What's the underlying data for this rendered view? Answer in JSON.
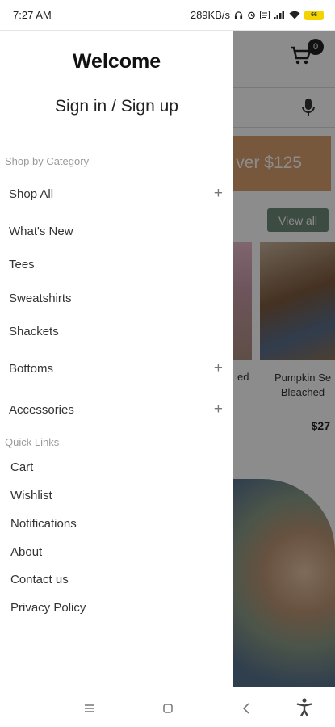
{
  "status": {
    "time": "7:27 AM",
    "speed": "289KB/s",
    "battery": "66"
  },
  "drawer": {
    "welcome": "Welcome",
    "signin": "Sign in / Sign up",
    "category_label": "Shop by Category",
    "categories": [
      {
        "label": "Shop All",
        "expandable": true
      },
      {
        "label": "What's New",
        "expandable": false
      },
      {
        "label": "Tees",
        "expandable": false
      },
      {
        "label": "Sweatshirts",
        "expandable": false
      },
      {
        "label": "Shackets",
        "expandable": false
      },
      {
        "label": "Bottoms",
        "expandable": true
      },
      {
        "label": "Accessories",
        "expandable": true
      }
    ],
    "quick_links_label": "Quick Links",
    "quick_links": [
      "Cart",
      "Wishlist",
      "Notifications",
      "About",
      "Contact us",
      "Privacy Policy"
    ],
    "plus_symbol": "+"
  },
  "background": {
    "cart_count": "0",
    "promo_text": "ver $125",
    "view_all": "View all",
    "product_cut_title": "ed",
    "product_title": "Pumpkin Se Bleached",
    "product_price": "$27"
  },
  "icons": {
    "cart": "cart-icon",
    "mic": "microphone-icon",
    "menu": "menu-icon",
    "home": "home-icon",
    "back": "back-icon",
    "accessibility": "accessibility-icon"
  },
  "colors": {
    "promo": "#d9a06d",
    "view_all_btn": "#6f8a7a",
    "overlay": "rgba(0,0,0,0.45)"
  }
}
